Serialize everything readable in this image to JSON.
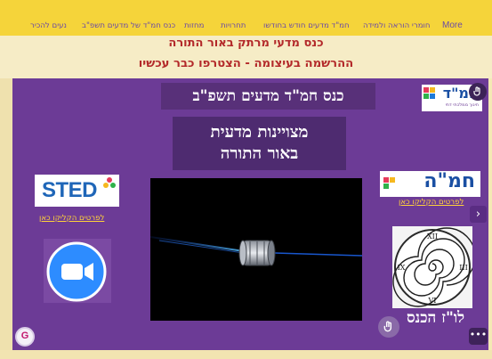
{
  "nav": {
    "items": [
      "נעים להכיר",
      "כנס חמ\"ד של מדעים תשפ\"ב",
      "מחזות",
      "תחרויות",
      "חמ\"ד מדעים חודש בחודשו",
      "חומרי הוראה ולמידה"
    ],
    "more_label": "More"
  },
  "hero": {
    "line1": "כנס מדעי מרתק באור התורה",
    "line2": "ההרשמה בעיצומה - הצטרפו כבר עכשיו"
  },
  "main": {
    "title": "כנס חמ\"ד מדעים תשפ\"ב",
    "subtitle_line1": "מצויינות מדעית",
    "subtitle_line2": "באור התורה",
    "logo_sted": "STED",
    "logo_hmmh": "חמ\"ה",
    "logo_topleft": "חמ\"ד",
    "logo_topleft_tagline": "חינוך ממלכתי דתי",
    "link_details_left": "לפרטים הקליקו כאן",
    "link_details_right": "לפרטים הקליקו כאן",
    "schedule_label": "לו\"ז הכנס"
  },
  "controls": {
    "next_glyph": "›",
    "more_glyph": "•••",
    "badge_letter": "G"
  },
  "colors": {
    "nav_bg": "#f5d43a",
    "nav_text": "#6a4aa6",
    "headline": "#b3292a",
    "stage_bg": "#6c3b96",
    "link": "#ffd23a",
    "zoom_blue": "#2d8cff"
  }
}
